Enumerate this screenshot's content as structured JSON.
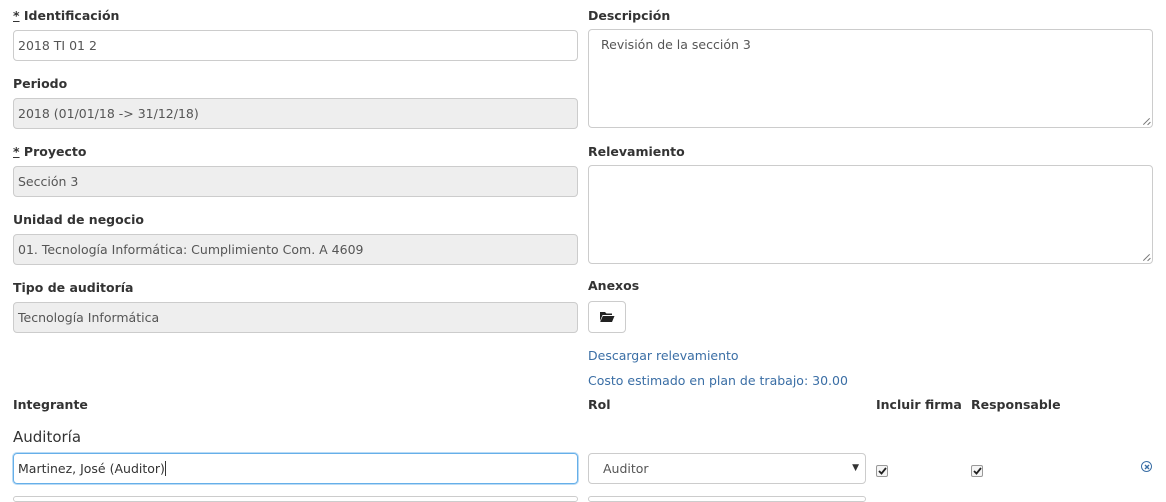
{
  "form": {
    "identificacion": {
      "required_mark": "*",
      "label": "Identificación",
      "value": "2018 TI 01 2"
    },
    "periodo": {
      "label": "Periodo",
      "value": "2018 (01/01/18 -> 31/12/18)"
    },
    "proyecto": {
      "required_mark": "*",
      "label": "Proyecto",
      "value": "Sección 3"
    },
    "unidad": {
      "label": "Unidad de negocio",
      "value": "01. Tecnología Informática: Cumplimiento Com. A 4609"
    },
    "tipo": {
      "label": "Tipo de auditoría",
      "value": "Tecnología Informática"
    },
    "descripcion": {
      "label": "Descripción",
      "value": "Revisión de la sección 3"
    },
    "relevamiento": {
      "label": "Relevamiento",
      "value": ""
    },
    "anexos": {
      "label": "Anexos",
      "button_icon": "folder-open-icon"
    },
    "links": {
      "descargar": "Descargar relevamiento",
      "costo": "Costo estimado en plan de trabajo: 30.00"
    }
  },
  "members": {
    "headers": {
      "integrante": "Integrante",
      "rol": "Rol",
      "firma": "Incluir firma",
      "responsable": "Responsable"
    },
    "section_title": "Auditoría",
    "rows": [
      {
        "integrante": "Martinez, José (Auditor)",
        "rol": "Auditor",
        "incluir_firma": true,
        "responsable": true,
        "remove_icon": "remove-circle-icon"
      }
    ]
  },
  "colors": {
    "link": "#3a6ea5",
    "readonly_bg": "#eeeeee",
    "focus_border": "#66afe9"
  }
}
